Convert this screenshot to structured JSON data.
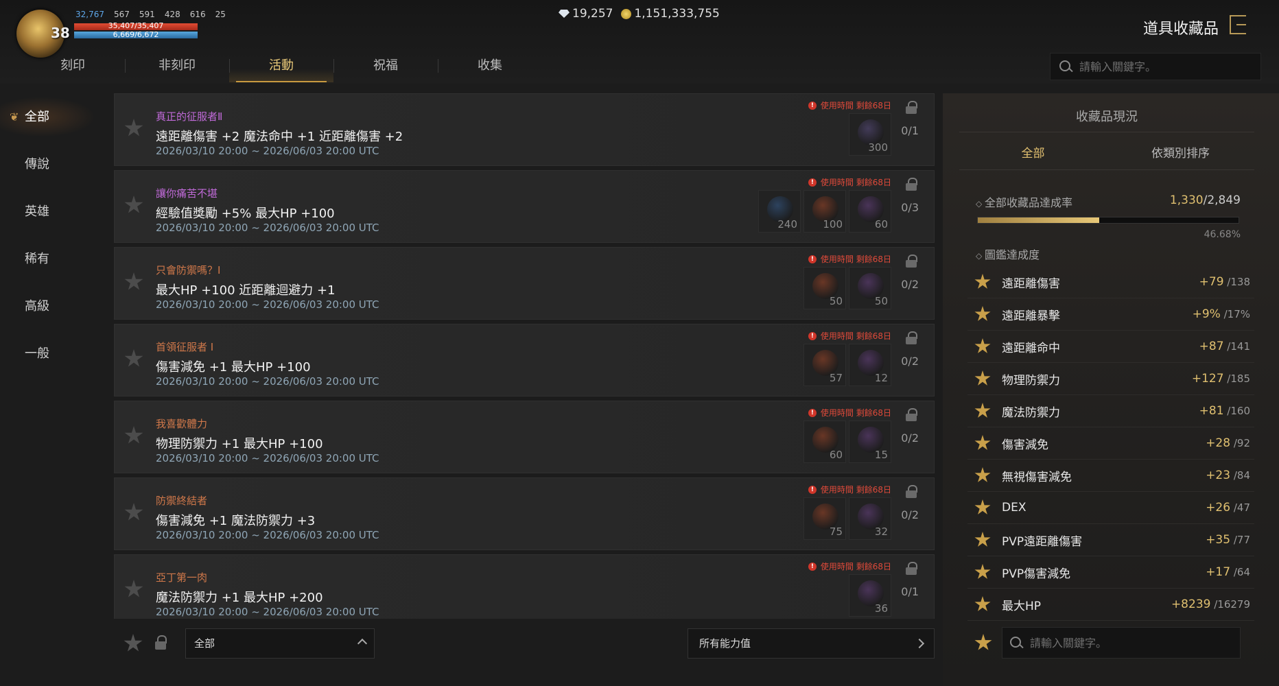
{
  "header": {
    "level": "38",
    "stats": [
      "32,767",
      "567",
      "591",
      "428",
      "616",
      "25"
    ],
    "hp": "35,407/35,407",
    "mp": "6,669/6,672",
    "currency": {
      "diamond": "19,257",
      "gold": "1,151,333,755"
    },
    "title": "道具收藏品"
  },
  "tabs": [
    {
      "label": "刻印"
    },
    {
      "label": "非刻印"
    },
    {
      "label": "活動"
    },
    {
      "label": "祝福"
    },
    {
      "label": "收集"
    }
  ],
  "search": {
    "placeholder": "請輸入關鍵字。"
  },
  "sidebar": {
    "items": [
      {
        "label": "全部"
      },
      {
        "label": "傳說"
      },
      {
        "label": "英雄"
      },
      {
        "label": "稀有"
      },
      {
        "label": "高級"
      },
      {
        "label": "一般"
      }
    ]
  },
  "items": [
    {
      "name": "真正的征服者Ⅱ",
      "name_color": "#c06ad8",
      "effect": "遠距離傷害 +2 魔法命中 +1 近距離傷害 +2",
      "date": "2026/03/10 20:00 ~ 2026/06/03 20:00 UTC",
      "warning": "使用時間 剩餘68日",
      "ratio": "0/1",
      "slots": [
        {
          "num": "300",
          "color": "#6a5a9a"
        }
      ]
    },
    {
      "name": "讓你痛苦不堪",
      "name_color": "#c06ad8",
      "effect": "經驗值獎勵 +5% 最大HP +100",
      "date": "2026/03/10 20:00 ~ 2026/06/03 20:00 UTC",
      "warning": "使用時間 剩餘68日",
      "ratio": "0/3",
      "slots": [
        {
          "num": "240",
          "color": "#3a6aa8"
        },
        {
          "num": "100",
          "color": "#c0502a"
        },
        {
          "num": "60",
          "color": "#7a4a9a"
        }
      ]
    },
    {
      "name": "只會防禦嗎？Ⅰ",
      "name_color": "#d0784a",
      "effect": "最大HP +100 近距離迴避力 +1",
      "date": "2026/03/10 20:00 ~ 2026/06/03 20:00 UTC",
      "warning": "使用時間 剩餘68日",
      "ratio": "0/2",
      "slots": [
        {
          "num": "50",
          "color": "#c0502a"
        },
        {
          "num": "50",
          "color": "#7a4a9a"
        }
      ]
    },
    {
      "name": "首領征服者 Ⅰ",
      "name_color": "#d0784a",
      "effect": "傷害減免 +1 最大HP +100",
      "date": "2026/03/10 20:00 ~ 2026/06/03 20:00 UTC",
      "warning": "使用時間 剩餘68日",
      "ratio": "0/2",
      "slots": [
        {
          "num": "57",
          "color": "#c0502a"
        },
        {
          "num": "12",
          "color": "#7a4a9a"
        }
      ]
    },
    {
      "name": "我喜歡體力",
      "name_color": "#d0784a",
      "effect": "物理防禦力 +1 最大HP +100",
      "date": "2026/03/10 20:00 ~ 2026/06/03 20:00 UTC",
      "warning": "使用時間 剩餘68日",
      "ratio": "0/2",
      "slots": [
        {
          "num": "60",
          "color": "#c0502a"
        },
        {
          "num": "15",
          "color": "#7a4a9a"
        }
      ]
    },
    {
      "name": "防禦終結者",
      "name_color": "#d0784a",
      "effect": "傷害減免 +1 魔法防禦力 +3",
      "date": "2026/03/10 20:00 ~ 2026/06/03 20:00 UTC",
      "warning": "使用時間 剩餘68日",
      "ratio": "0/2",
      "slots": [
        {
          "num": "75",
          "color": "#c0502a"
        },
        {
          "num": "32",
          "color": "#7a4a9a"
        }
      ]
    },
    {
      "name": "亞丁第一肉",
      "name_color": "#d0784a",
      "effect": "魔法防禦力 +1 最大HP +200",
      "date": "2026/03/10 20:00 ~ 2026/06/03 20:00 UTC",
      "warning": "使用時間 剩餘68日",
      "ratio": "0/1",
      "slots": [
        {
          "num": "36",
          "color": "#7a4a9a"
        }
      ]
    }
  ],
  "footer": {
    "dropdown": "全部",
    "all_stats": "所有能力值"
  },
  "right_panel": {
    "title": "收藏品現況",
    "tabs": [
      {
        "label": "全部"
      },
      {
        "label": "依類別排序"
      }
    ],
    "rate_label": "全部收藏品達成率",
    "rate_current": "1,330",
    "rate_total": "2,849",
    "rate_percent": "46.68%",
    "rate_fraction": 0.4668,
    "dex_label": "圖鑑達成度",
    "stats": [
      {
        "name": "遠距離傷害",
        "value": "+79",
        "max": "138"
      },
      {
        "name": "遠距離暴擊",
        "value": "+9%",
        "max": "17%"
      },
      {
        "name": "遠距離命中",
        "value": "+87",
        "max": "141"
      },
      {
        "name": "物理防禦力",
        "value": "+127",
        "max": "185"
      },
      {
        "name": "魔法防禦力",
        "value": "+81",
        "max": "160"
      },
      {
        "name": "傷害減免",
        "value": "+28",
        "max": "92"
      },
      {
        "name": "無視傷害減免",
        "value": "+23",
        "max": "84"
      },
      {
        "name": "DEX",
        "value": "+26",
        "max": "47"
      },
      {
        "name": "PVP遠距離傷害",
        "value": "+35",
        "max": "77"
      },
      {
        "name": "PVP傷害減免",
        "value": "+17",
        "max": "64"
      },
      {
        "name": "最大HP",
        "value": "+8239",
        "max": "16279"
      }
    ],
    "search_placeholder": "請輸入關鍵字。"
  },
  "colors": {
    "accent": "#e2c070",
    "warning": "#e04a3a",
    "date": "#8fa6b6"
  }
}
